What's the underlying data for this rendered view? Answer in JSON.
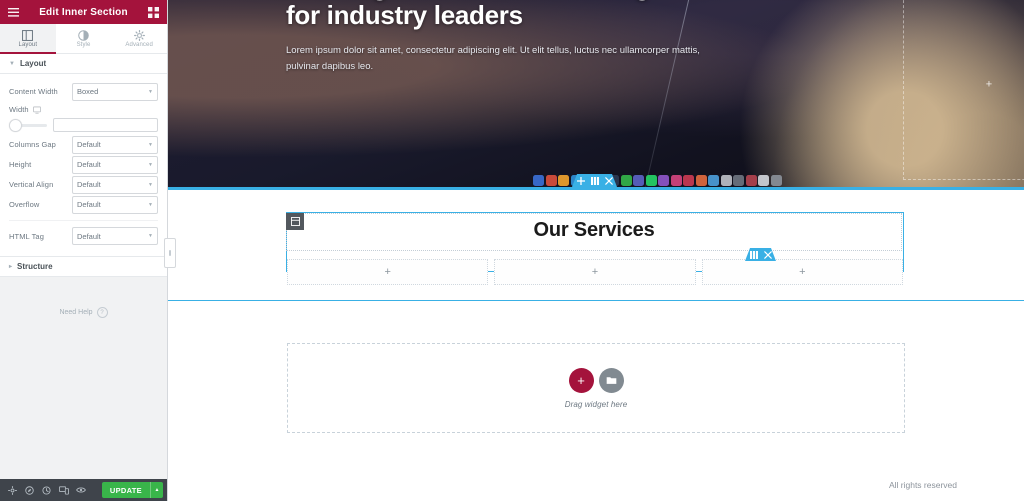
{
  "panel": {
    "header": {
      "title": "Edit Inner Section",
      "menu_icon": "hamburger-menu-icon",
      "grid_icon": "widgets-grid-icon"
    },
    "tabs": [
      {
        "label": "Layout",
        "icon": "layout-columns-icon",
        "active": true
      },
      {
        "label": "Style",
        "icon": "contrast-circle-icon",
        "active": false
      },
      {
        "label": "Advanced",
        "icon": "gear-icon",
        "active": false
      }
    ],
    "sections": [
      {
        "title": "Layout",
        "expanded": true,
        "controls": [
          {
            "label": "Content Width",
            "type": "select",
            "value": "Boxed"
          },
          {
            "label": "Width",
            "type": "slider",
            "value": "",
            "placeholder": "",
            "device_icon": "desktop-icon"
          },
          {
            "label": "Columns Gap",
            "type": "select",
            "value": "Default"
          },
          {
            "label": "Height",
            "type": "select",
            "value": "Default"
          },
          {
            "label": "Vertical Align",
            "type": "select",
            "value": "Default"
          },
          {
            "label": "Overflow",
            "type": "select",
            "value": "Default"
          },
          {
            "label": "HTML Tag",
            "type": "select",
            "value": "Default"
          }
        ]
      },
      {
        "title": "Structure",
        "expanded": false,
        "controls": []
      }
    ],
    "need_help": {
      "label": "Need Help",
      "icon": "question-mark-icon"
    },
    "footer": {
      "buttons": [
        {
          "name": "settings-icon",
          "title": "Settings"
        },
        {
          "name": "navigator-icon",
          "title": "Navigator"
        },
        {
          "name": "history-icon",
          "title": "History"
        },
        {
          "name": "responsive-mode-icon",
          "title": "Responsive Mode"
        },
        {
          "name": "preview-changes-icon",
          "title": "Preview Changes"
        }
      ],
      "update_label": "UPDATE",
      "update_arrow": "chevron-up-icon"
    },
    "accent_color": "#a4133c",
    "update_color": "#39b54a"
  },
  "canvas": {
    "hero": {
      "heading": "Building innovative web designs for industry leaders",
      "paragraph": "Lorem ipsum dolor sit amet, consectetur adipiscing elit. Ut elit tellus, luctus nec ullamcorper mattis, pulvinar dapibus leo.",
      "placeholder_plus": "+",
      "toolbar": [
        {
          "name": "drag-section-icon"
        },
        {
          "name": "section-settings-icon"
        },
        {
          "name": "close-icon"
        }
      ]
    },
    "services": {
      "title": "Our Services",
      "widget_handle_icon": "heading-widget-icon",
      "inner_toolbar": [
        {
          "name": "inner-section-settings-icon"
        },
        {
          "name": "close-icon"
        }
      ],
      "columns": [
        {
          "add_label": "+"
        },
        {
          "add_label": "+"
        },
        {
          "add_label": "+"
        }
      ]
    },
    "drop_area": {
      "label": "Drag widget here",
      "add_icon": "plus-icon",
      "template_icon": "folder-template-icon"
    },
    "footer_text": "All rights reserved",
    "selection_color": "#39b0e5"
  }
}
